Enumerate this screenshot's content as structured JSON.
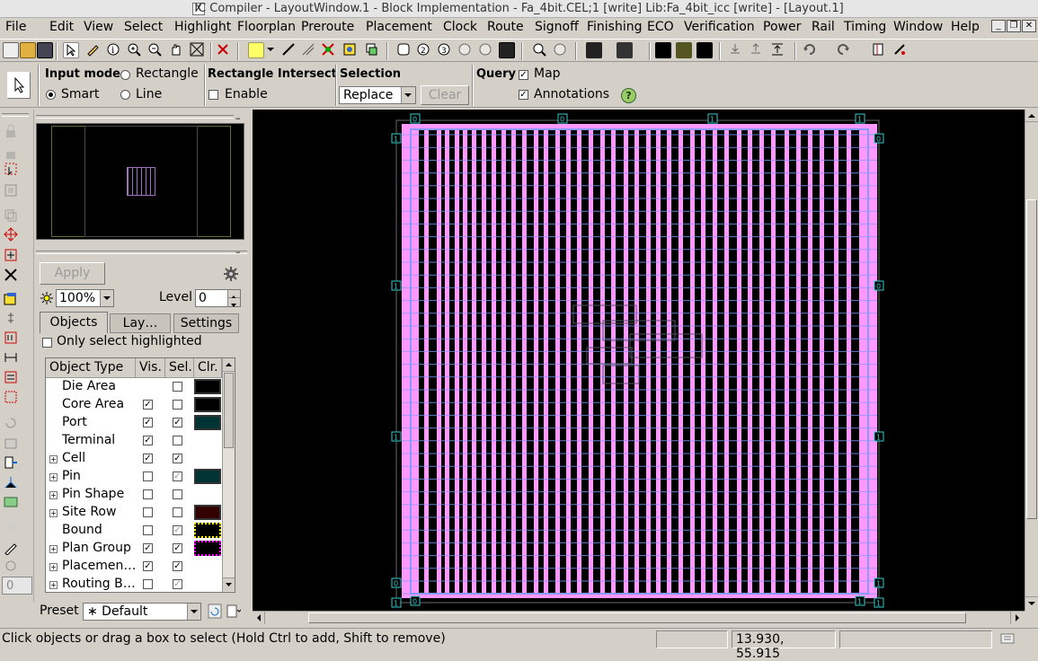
{
  "window": {
    "title": "IC Compiler - LayoutWindow.1 - Block Implementation - Fa_4bit.CEL;1 [write]    Lib:Fa_4bit_icc [write] - [Layout.1]",
    "controls": [
      "_",
      "❐",
      "✕"
    ]
  },
  "menu": [
    "File",
    "Edit",
    "View",
    "Select",
    "Highlight",
    "Floorplan",
    "Preroute",
    "Placement",
    "Clock",
    "Route",
    "Signoff",
    "Finishing",
    "ECO",
    "Verification",
    "Power",
    "Rail",
    "Timing",
    "Window",
    "Help"
  ],
  "options": {
    "input_mode_label": "Input mode",
    "rect_label": "Rectangle",
    "smart_label": "Smart",
    "line_label": "Line",
    "rect_intersect_label": "Rectangle Intersect",
    "enable_label": "Enable",
    "selection_label": "Selection",
    "selection_value": "Replace",
    "clear_label": "Clear",
    "query_label": "Query",
    "map_label": "Map",
    "annotations_label": "Annotations",
    "help_glyph": "?"
  },
  "panel": {
    "apply_label": "Apply",
    "zoom_value": "100%",
    "level_label": "Level",
    "level_value": "0",
    "tabs": [
      "Objects",
      "Lay…",
      "Settings"
    ],
    "only_highlighted_label": "Only select highlighted",
    "headers": [
      "Object Type",
      "Vis.",
      "Sel.",
      "Clr."
    ],
    "rows": [
      {
        "name": "Die Area",
        "expand": false,
        "vis": null,
        "sel": false,
        "vis_dim": false,
        "sel_dim": false,
        "color": "#000000",
        "swatch": "solid"
      },
      {
        "name": "Core Area",
        "expand": false,
        "vis": true,
        "sel": false,
        "vis_dim": false,
        "sel_dim": false,
        "color": "#000000",
        "swatch": "solid"
      },
      {
        "name": "Port",
        "expand": false,
        "vis": true,
        "sel": true,
        "vis_dim": false,
        "sel_dim": false,
        "color": "#003333",
        "swatch": "solid"
      },
      {
        "name": "Terminal",
        "expand": false,
        "vis": true,
        "sel": false,
        "vis_dim": false,
        "sel_dim": false,
        "color": null,
        "swatch": "none"
      },
      {
        "name": "Cell",
        "expand": true,
        "vis": true,
        "sel": true,
        "vis_dim": false,
        "sel_dim": false,
        "color": null,
        "swatch": "none"
      },
      {
        "name": "Pin",
        "expand": true,
        "vis": false,
        "sel": true,
        "vis_dim": false,
        "sel_dim": true,
        "color": "#003333",
        "swatch": "solid"
      },
      {
        "name": "Pin Shape",
        "expand": true,
        "vis": false,
        "sel": false,
        "vis_dim": false,
        "sel_dim": false,
        "color": null,
        "swatch": "none"
      },
      {
        "name": "Site Row",
        "expand": true,
        "vis": false,
        "sel": false,
        "vis_dim": false,
        "sel_dim": false,
        "color": "#330000",
        "swatch": "solid"
      },
      {
        "name": "Bound",
        "expand": false,
        "vis": false,
        "sel": true,
        "vis_dim": false,
        "sel_dim": true,
        "color": "#ffff00",
        "swatch": "dotted"
      },
      {
        "name": "Plan Group",
        "expand": true,
        "vis": true,
        "sel": true,
        "vis_dim": false,
        "sel_dim": false,
        "color": "#ff00ff",
        "swatch": "dotted"
      },
      {
        "name": "Placemen…",
        "expand": true,
        "vis": true,
        "sel": true,
        "vis_dim": false,
        "sel_dim": false,
        "color": null,
        "swatch": "none"
      },
      {
        "name": "Routing B…",
        "expand": true,
        "vis": false,
        "sel": true,
        "vis_dim": false,
        "sel_dim": true,
        "color": null,
        "swatch": "none"
      }
    ],
    "preset_label": "Preset",
    "preset_value": "∗ Default"
  },
  "canvas": {
    "core_color": "#ff99ff",
    "grid_color": "#8899ff",
    "handle_color": "#33cccc",
    "handle_labels": [
      "0",
      "0",
      "1",
      "1",
      "1",
      "0",
      "1",
      "0",
      "1",
      "1",
      "0",
      "1",
      "0",
      "1",
      "1",
      "1"
    ]
  },
  "left_field": "0",
  "status": {
    "message": "Click objects or drag a box to select (Hold Ctrl to add, Shift to remove)",
    "coords": "13.930, 55.915"
  }
}
